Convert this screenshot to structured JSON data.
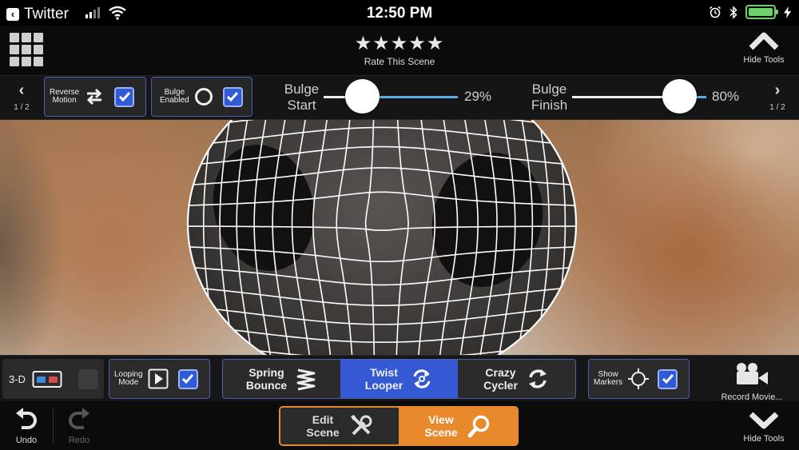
{
  "status_bar": {
    "back_app": "Twitter",
    "time": "12:50 PM",
    "icons": [
      "back-arrow-icon",
      "cellular-signal-icon",
      "wifi-icon",
      "alarm-icon",
      "bluetooth-icon",
      "battery-icon",
      "charging-bolt-icon"
    ]
  },
  "top_bar": {
    "menu_icon": "grid-menu-icon",
    "rating": {
      "stars": "★★★★★",
      "label": "Rate This Scene"
    },
    "hide_tools_label": "Hide Tools"
  },
  "params_bar": {
    "pager_left": {
      "page": "1 / 2"
    },
    "pager_right": {
      "page": "1 / 2"
    },
    "reverse_motion": {
      "label_line1": "Reverse",
      "label_line2": "Motion",
      "checked": true
    },
    "bulge_enabled": {
      "label_line1": "Bulge",
      "label_line2": "Enabled",
      "checked": true
    },
    "bulge_start": {
      "label_line1": "Bulge",
      "label_line2": "Start",
      "value_label": "29%",
      "value": 0.29
    },
    "bulge_finish": {
      "label_line1": "Bulge",
      "label_line2": "Finish",
      "value_label": "80%",
      "value": 0.8
    }
  },
  "modes_bar": {
    "three_d": {
      "label": "3-D",
      "checked": false
    },
    "looping_mode": {
      "label_line1": "Looping",
      "label_line2": "Mode",
      "checked": true
    },
    "effects": [
      {
        "line1": "Spring",
        "line2": "Bounce",
        "active": false
      },
      {
        "line1": "Twist",
        "line2": "Looper",
        "active": true
      },
      {
        "line1": "Crazy",
        "line2": "Cycler",
        "active": false
      }
    ],
    "show_markers": {
      "label_line1": "Show",
      "label_line2": "Markers",
      "checked": true
    },
    "record_label": "Record Movie..."
  },
  "bottom_bar": {
    "undo_label": "Undo",
    "redo_label": "Redo",
    "edit_scene": {
      "line1": "Edit",
      "line2": "Scene"
    },
    "view_scene": {
      "line1": "View",
      "line2": "Scene",
      "active": true
    },
    "hide_tools_label": "Hide Tools"
  },
  "colors": {
    "accent_blue": "#3558d3",
    "accent_orange": "#e8892c",
    "slider_fill": "#5aaee6",
    "battery": "#6cd36a"
  }
}
